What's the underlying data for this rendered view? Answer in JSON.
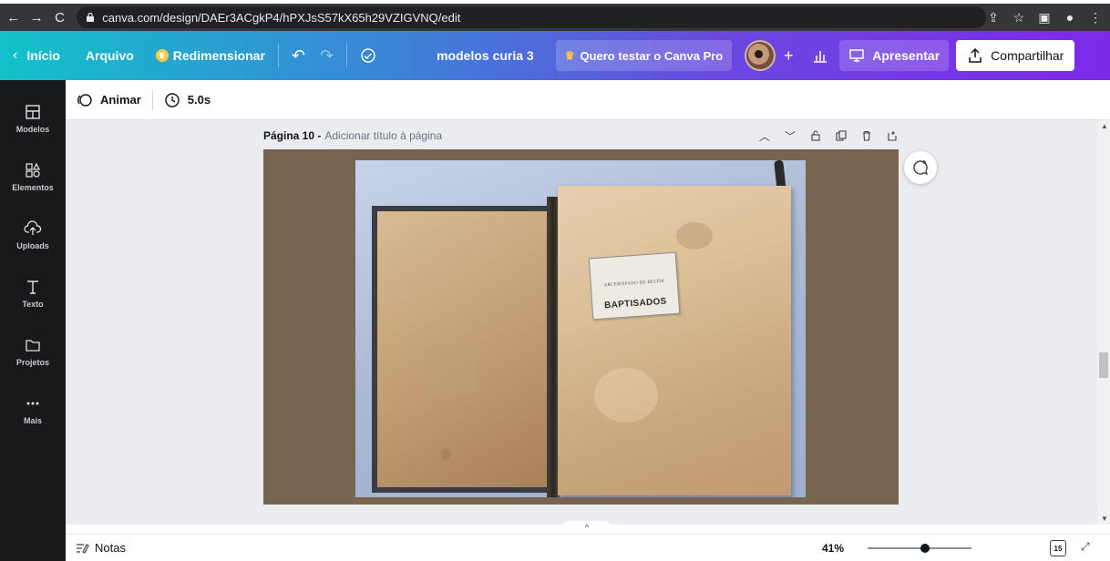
{
  "browser": {
    "url": "canva.com/design/DAEr3ACgkP4/hPXJsS57kX65h29VZIGVNQ/edit"
  },
  "topbar": {
    "home": "Início",
    "file": "Arquivo",
    "resize": "Redimensionar",
    "design_name": "modelos curia 3",
    "pro": "Quero testar o Canva Pro",
    "present": "Apresentar",
    "share": "Compartilhar"
  },
  "sidebar": {
    "items": [
      {
        "label": "Modelos",
        "icon": "templates-icon"
      },
      {
        "label": "Elementos",
        "icon": "elements-icon"
      },
      {
        "label": "Uploads",
        "icon": "uploads-icon"
      },
      {
        "label": "Texto",
        "icon": "text-icon"
      },
      {
        "label": "Projetos",
        "icon": "folder-icon"
      },
      {
        "label": "Mais",
        "icon": "more-icon"
      }
    ]
  },
  "animbar": {
    "animate": "Animar",
    "duration": "5.0s"
  },
  "page": {
    "title": "Página 10 -",
    "subtitle": "Adicionar título à página"
  },
  "photo": {
    "label_small": "ARCEBISPADO DE BELÉM",
    "label_main": "BAPTISADOS"
  },
  "bottombar": {
    "notes": "Notas",
    "zoom": "41%",
    "zoom_level": 0.55,
    "page_count": "15"
  },
  "colors": {
    "topbar_start": "#12c2c9",
    "topbar_end": "#7d2ae8",
    "sidebar_bg": "#18191b",
    "design_bg": "#786550"
  }
}
